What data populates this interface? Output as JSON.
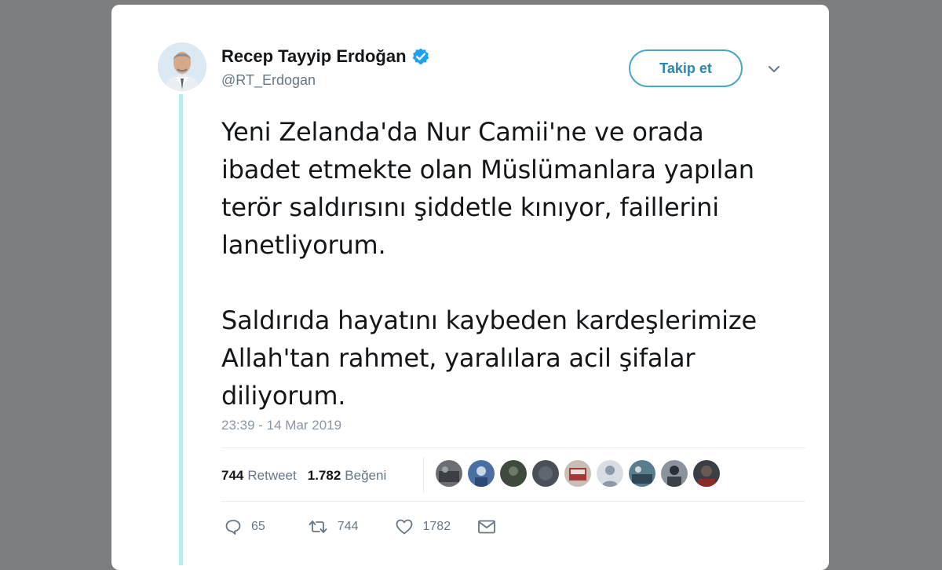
{
  "author": {
    "display_name": "Recep Tayyip Erdoğan",
    "handle": "@RT_Erdogan",
    "verified": true
  },
  "follow_button_label": "Takip et",
  "tweet": {
    "paragraph_1": "Yeni Zelanda'da Nur Camii'ne ve orada ibadet etmekte olan Müslümanlara yapılan terör saldırısını şiddetle kınıyor, faillerini lanetliyorum.",
    "paragraph_2": "Saldırıda hayatını kaybeden kardeşlerimize Allah'tan rahmet, yaralılara acil şifalar diliyorum.",
    "timestamp": "23:39 - 14 Mar 2019"
  },
  "stats": {
    "retweet_count": "744",
    "retweet_label": "Retweet",
    "like_count": "1.782",
    "like_label": "Beğeni"
  },
  "actions": {
    "reply_count": "65",
    "retweet_count": "744",
    "like_count": "1782"
  },
  "icons": {
    "verified": "verified-badge-icon",
    "caret": "chevron-down-icon",
    "reply": "reply-icon",
    "retweet": "retweet-icon",
    "like": "heart-icon",
    "message": "envelope-icon"
  },
  "colors": {
    "background": "#7b7d81",
    "card": "#ffffff",
    "accent": "#1da1f2",
    "thread_line": "#b9ecef",
    "text": "#14171a",
    "muted": "#657786"
  }
}
